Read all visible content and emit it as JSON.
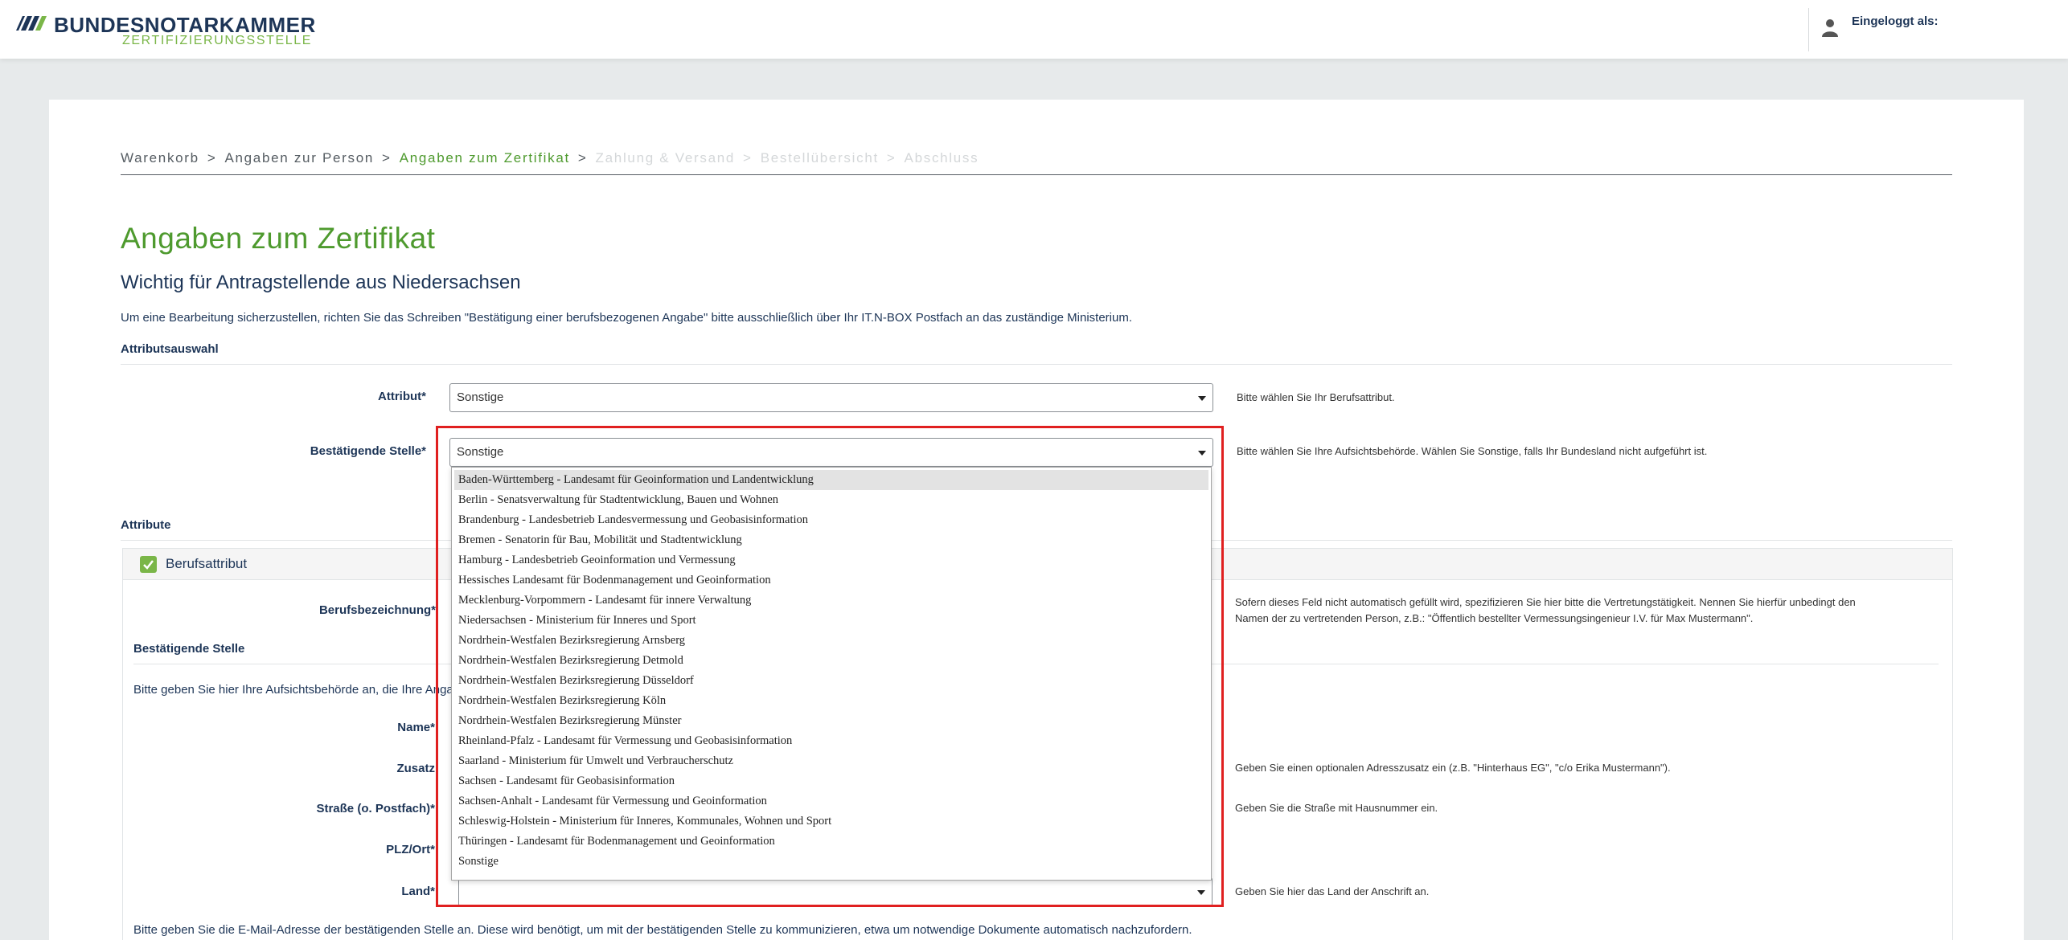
{
  "header": {
    "brand": "BUNDESNOTARKAMMER",
    "subbrand": "ZERTIFIZIERUNGSSTELLE",
    "user_label": "Eingeloggt als:"
  },
  "breadcrumb": {
    "steps": [
      {
        "label": "Warenkorb",
        "state": "done"
      },
      {
        "label": "Angaben zur Person",
        "state": "done"
      },
      {
        "label": "Angaben zum Zertifikat",
        "state": "active"
      },
      {
        "label": "Zahlung & Versand",
        "state": "todo"
      },
      {
        "label": "Bestellübersicht",
        "state": "todo"
      },
      {
        "label": "Abschluss",
        "state": "todo"
      }
    ],
    "separator": ">"
  },
  "page": {
    "title": "Angaben zum Zertifikat",
    "subtitle": "Wichtig für Antragstellende aus Niedersachsen",
    "note": "Um eine Bearbeitung sicherzustellen, richten Sie das Schreiben \"Bestätigung einer berufsbezogenen Angabe\" bitte ausschließlich über Ihr IT.N-BOX Postfach an das zuständige Ministerium."
  },
  "attributsauswahl": {
    "section_title": "Attributsauswahl",
    "attribut": {
      "label": "Attribut*",
      "value": "Sonstige",
      "hint": "Bitte wählen Sie Ihr Berufsattribut."
    },
    "stelle": {
      "label": "Bestätigende Stelle*",
      "value": "Sonstige",
      "hint": "Bitte wählen Sie Ihre Aufsichtsbehörde. Wählen Sie Sonstige, falls Ihr Bundesland nicht aufgeführt ist."
    }
  },
  "dropdown": {
    "highlighted_index": 0,
    "options": [
      "Baden-Württemberg - Landesamt für Geoinformation und Landentwicklung",
      "Berlin - Senatsverwaltung für Stadtentwicklung, Bauen und Wohnen",
      "Brandenburg - Landesbetrieb Landesvermessung und Geobasisinformation",
      "Bremen - Senatorin für Bau, Mobilität und Stadtentwicklung",
      "Hamburg - Landesbetrieb Geoinformation und Vermessung",
      "Hessisches Landesamt für Bodenmanagement und Geoinformation",
      "Mecklenburg-Vorpommern - Landesamt für innere Verwaltung",
      "Niedersachsen - Ministerium für Inneres und Sport",
      "Nordrhein-Westfalen Bezirksregierung Arnsberg",
      "Nordrhein-Westfalen Bezirksregierung Detmold",
      "Nordrhein-Westfalen Bezirksregierung Düsseldorf",
      "Nordrhein-Westfalen Bezirksregierung Köln",
      "Nordrhein-Westfalen Bezirksregierung Münster",
      "Rheinland-Pfalz - Landesamt für Vermessung und Geobasisinformation",
      "Saarland - Ministerium für Umwelt und Verbraucherschutz",
      "Sachsen - Landesamt für Geobasisinformation",
      "Sachsen-Anhalt - Landesamt für Vermessung und Geoinformation",
      "Schleswig-Holstein - Ministerium für Inneres, Kommunales, Wohnen und Sport",
      "Thüringen - Landesamt für Bodenmanagement und Geoinformation",
      "Sonstige"
    ]
  },
  "attribute": {
    "section_title": "Attribute",
    "panel_title": "Berufsattribut",
    "berufsbezeichnung": {
      "label": "Berufsbezeichnung*",
      "hint_line1": "Sofern dieses Feld nicht automatisch gefüllt wird, spezifizieren Sie hier bitte die Vertretungstätigkeit. Nennen Sie hierfür unbedingt den",
      "hint_line2": "Namen der zu vertretenden Person, z.B.: \"Öffentlich bestellter Vermessungsingenieur I.V. für Max Mustermann\"."
    },
    "bestaetigende_stelle_title": "Bestätigende Stelle",
    "intro_text": "Bitte geben Sie hier Ihre Aufsichtsbehörde an, die Ihre Angabe",
    "name_label": "Name*",
    "zusatz": {
      "label": "Zusatz",
      "hint": "Geben Sie einen optionalen Adresszusatz ein (z.B. \"Hinterhaus EG\", \"c/o Erika Mustermann\")."
    },
    "strasse": {
      "label": "Straße (o. Postfach)*",
      "hint": "Geben Sie die Straße mit Hausnummer ein."
    },
    "plz_label": "PLZ/Ort*",
    "land": {
      "label": "Land*",
      "value": "",
      "hint": "Geben Sie hier das Land der Anschrift an."
    },
    "email_text": "Bitte geben Sie die E-Mail-Adresse der bestätigenden Stelle an. Diese wird benötigt, um mit der bestätigenden Stelle zu kommunizieren, etwa um notwendige Dokumente automatisch nachzufordern."
  },
  "colors": {
    "brand_navy": "#1d3557",
    "brand_green": "#7ab648",
    "active_green": "#4e9a2e",
    "highlight_red": "#e02020"
  }
}
